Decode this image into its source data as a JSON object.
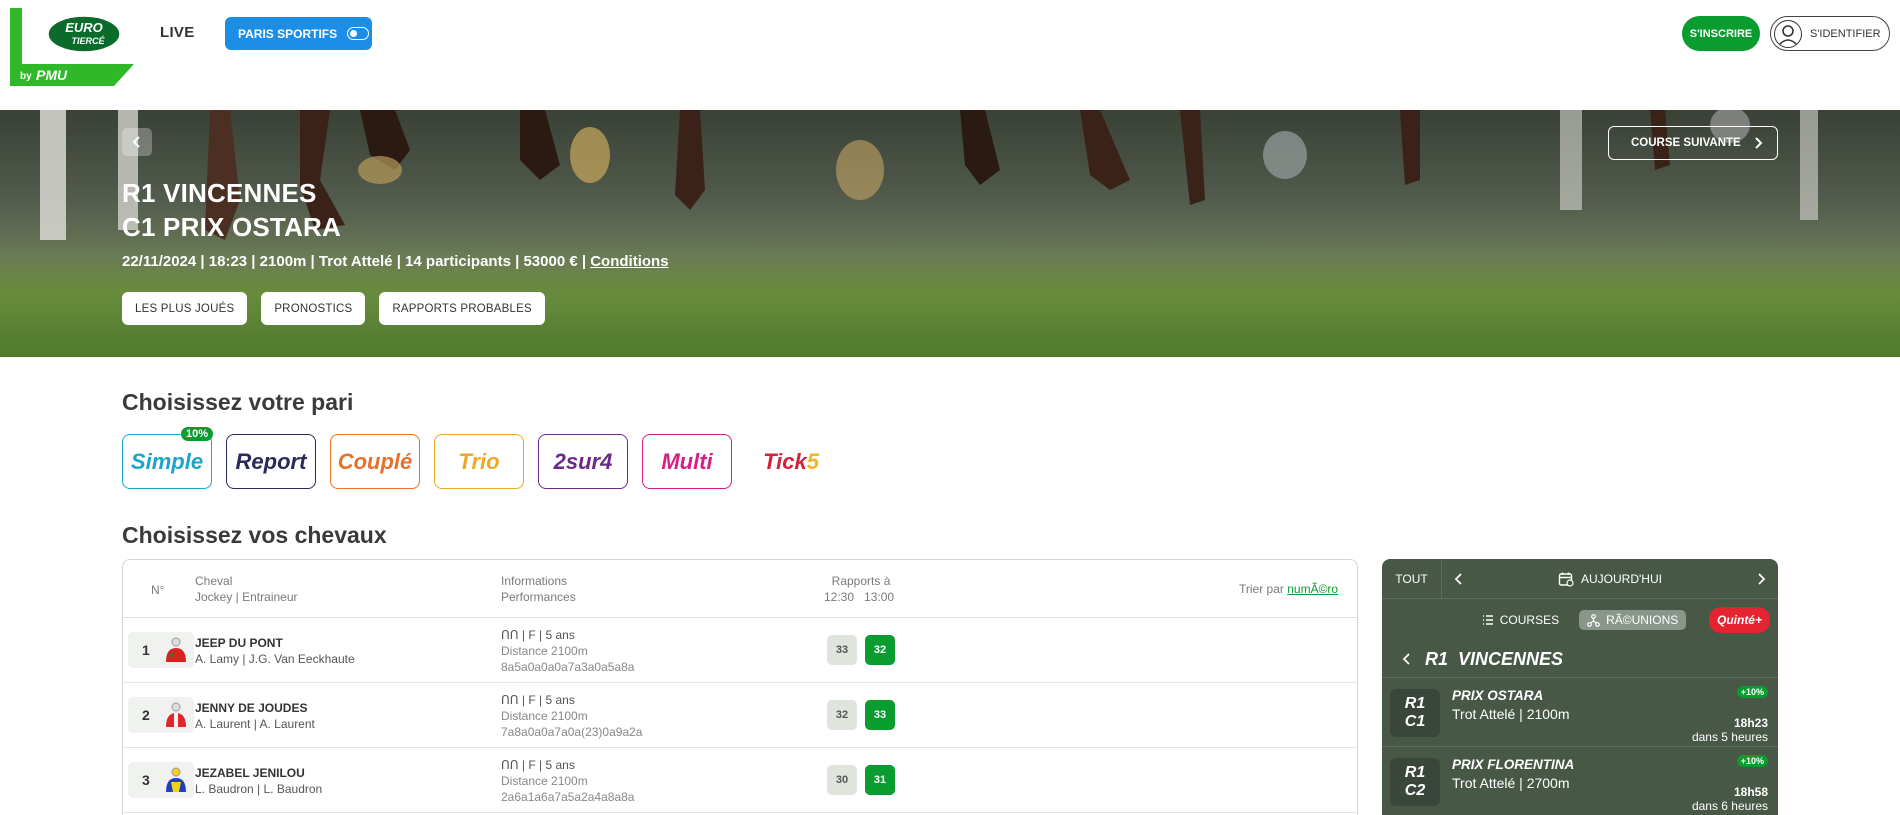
{
  "header": {
    "logo_top": "EURO",
    "logo_bottom": "TIERCÉ",
    "logo_by": "by",
    "logo_pmu": "PMU",
    "nav_live": "LIVE",
    "paris_sportifs": "PARIS SPORTIFS",
    "signup": "S'INSCRIRE",
    "login": "S'IDENTIFIER"
  },
  "hero": {
    "title_line1": "R1 VINCENNES",
    "title_line2": "C1 PRIX OSTARA",
    "info": "22/11/2024 | 18:23 | 2100m | Trot Attelé | 14 participants | 53000 € | ",
    "conditions_link": "Conditions",
    "pills": [
      "LES PLUS JOUÉS",
      "PRONOSTICS",
      "RAPPORTS PROBABLES"
    ],
    "next_race": "COURSE SUIVANTE"
  },
  "bet_section": {
    "title": "Choisissez votre pari",
    "types": [
      {
        "label": "Simple",
        "color": "#1aa6c8",
        "badge": "10%"
      },
      {
        "label": "Report",
        "color": "#2a2a5a"
      },
      {
        "label": "Couplé",
        "color": "#e8702a"
      },
      {
        "label": "Trio",
        "color": "#f0a81e"
      },
      {
        "label": "2sur4",
        "color": "#6a2a8a"
      },
      {
        "label": "Multi",
        "color": "#d61f86"
      },
      {
        "label": "Tick",
        "suffix": "5",
        "color": "#d6213a",
        "suffix_color": "#f0b81e"
      }
    ]
  },
  "horses_section": {
    "title": "Choisissez vos chevaux",
    "columns": {
      "num": "N°",
      "cheval": "Cheval",
      "jockey_trainer": "Jockey | Entraineur",
      "informations": "Informations",
      "performances": "Performances",
      "rapports": "Rapports à",
      "rapport_times": "12:30   13:00",
      "sort_label": "Trier par ",
      "sort_link": "numÃ©ro"
    },
    "rows": [
      {
        "num": "1",
        "name": "JEEP DU PONT",
        "jockey": "A. Lamy | J.G. Van Eeckhaute",
        "info": "ᑎᑎ | F | 5 ans",
        "distance": "Distance 2100m",
        "perf": "8a5a0a0a0a7a3a0a5a8a",
        "odd1": "33",
        "odd2": "32",
        "silk": "red"
      },
      {
        "num": "2",
        "name": "JENNY DE JOUDES",
        "jockey": "A. Laurent | A. Laurent",
        "info": "ᑎᑎ | F | 5 ans",
        "distance": "Distance 2100m",
        "perf": "7a8a0a0a7a0a(23)0a9a2a",
        "odd1": "32",
        "odd2": "33",
        "silk": "red"
      },
      {
        "num": "3",
        "name": "JEZABEL JENILOU",
        "jockey": "L. Baudron | L. Baudron",
        "info": "ᑎᑎ | F | 5 ans",
        "distance": "Distance 2100m",
        "perf": "2a6a1a6a7a5a2a4a8a8a",
        "odd1": "30",
        "odd2": "31",
        "silk": "blue"
      }
    ]
  },
  "panel": {
    "tout": "TOUT",
    "date": "AUJOURD'HUI",
    "tab_courses": "COURSES",
    "tab_reunions": "RÃ©UNIONS",
    "quinte": "Quinté+",
    "reunion_code": "R1",
    "reunion_name": "VINCENNES",
    "races": [
      {
        "r": "R1",
        "c": "C1",
        "name": "PRIX OSTARA",
        "type": "Trot Attelé | 2100m",
        "badge": "+10%",
        "time": "18h23",
        "relative": "dans 5 heures"
      },
      {
        "r": "R1",
        "c": "C2",
        "name": "PRIX FLORENTINA",
        "type": "Trot Attelé | 2700m",
        "badge": "+10%",
        "time": "18h58",
        "relative": "dans 6 heures"
      }
    ]
  }
}
